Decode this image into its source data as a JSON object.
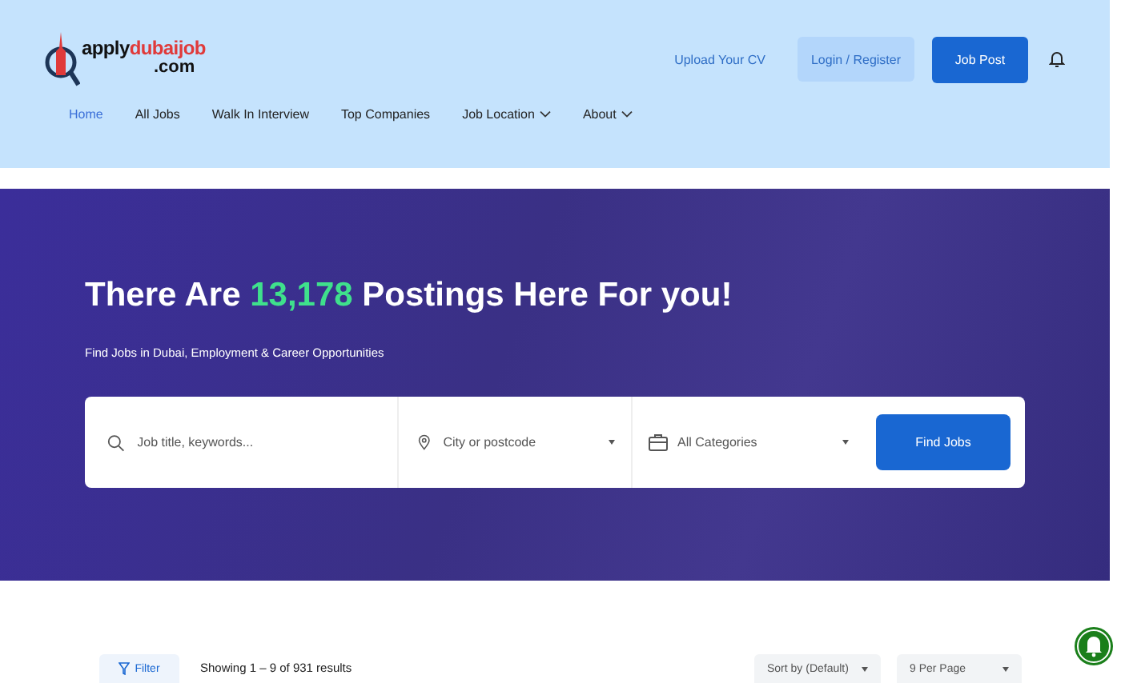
{
  "logo": {
    "name_dark": "apply",
    "name_accent": "dubaijob",
    "domain": ".com"
  },
  "nav": [
    {
      "label": "Home",
      "selected": true,
      "dropdown": false
    },
    {
      "label": "All Jobs",
      "selected": false,
      "dropdown": false
    },
    {
      "label": "Walk In Interview",
      "selected": false,
      "dropdown": false
    },
    {
      "label": "Top Companies",
      "selected": false,
      "dropdown": false
    },
    {
      "label": "Job Location",
      "selected": false,
      "dropdown": true
    },
    {
      "label": "About",
      "selected": false,
      "dropdown": true
    }
  ],
  "header_actions": {
    "upload_link": "Upload Your CV",
    "login_button": "Login / Register",
    "post_button": "Job Post"
  },
  "hero": {
    "title_before": "There Are",
    "title_count": "13,178",
    "title_after": "Postings Here For you!",
    "subtitle": "Find Jobs in Dubai, Employment & Career Opportunities"
  },
  "search": {
    "keywords": {
      "placeholder": "Job title, keywords..."
    },
    "location": {
      "placeholder": "City or postcode"
    },
    "category": {
      "value": "All Categories"
    },
    "button": "Find Jobs"
  },
  "results_bar": {
    "filter_button": "Filter",
    "summary": "Showing 1 – 9 of 931 results",
    "sort": "Sort by (Default)",
    "per_page": "9 Per Page"
  }
}
